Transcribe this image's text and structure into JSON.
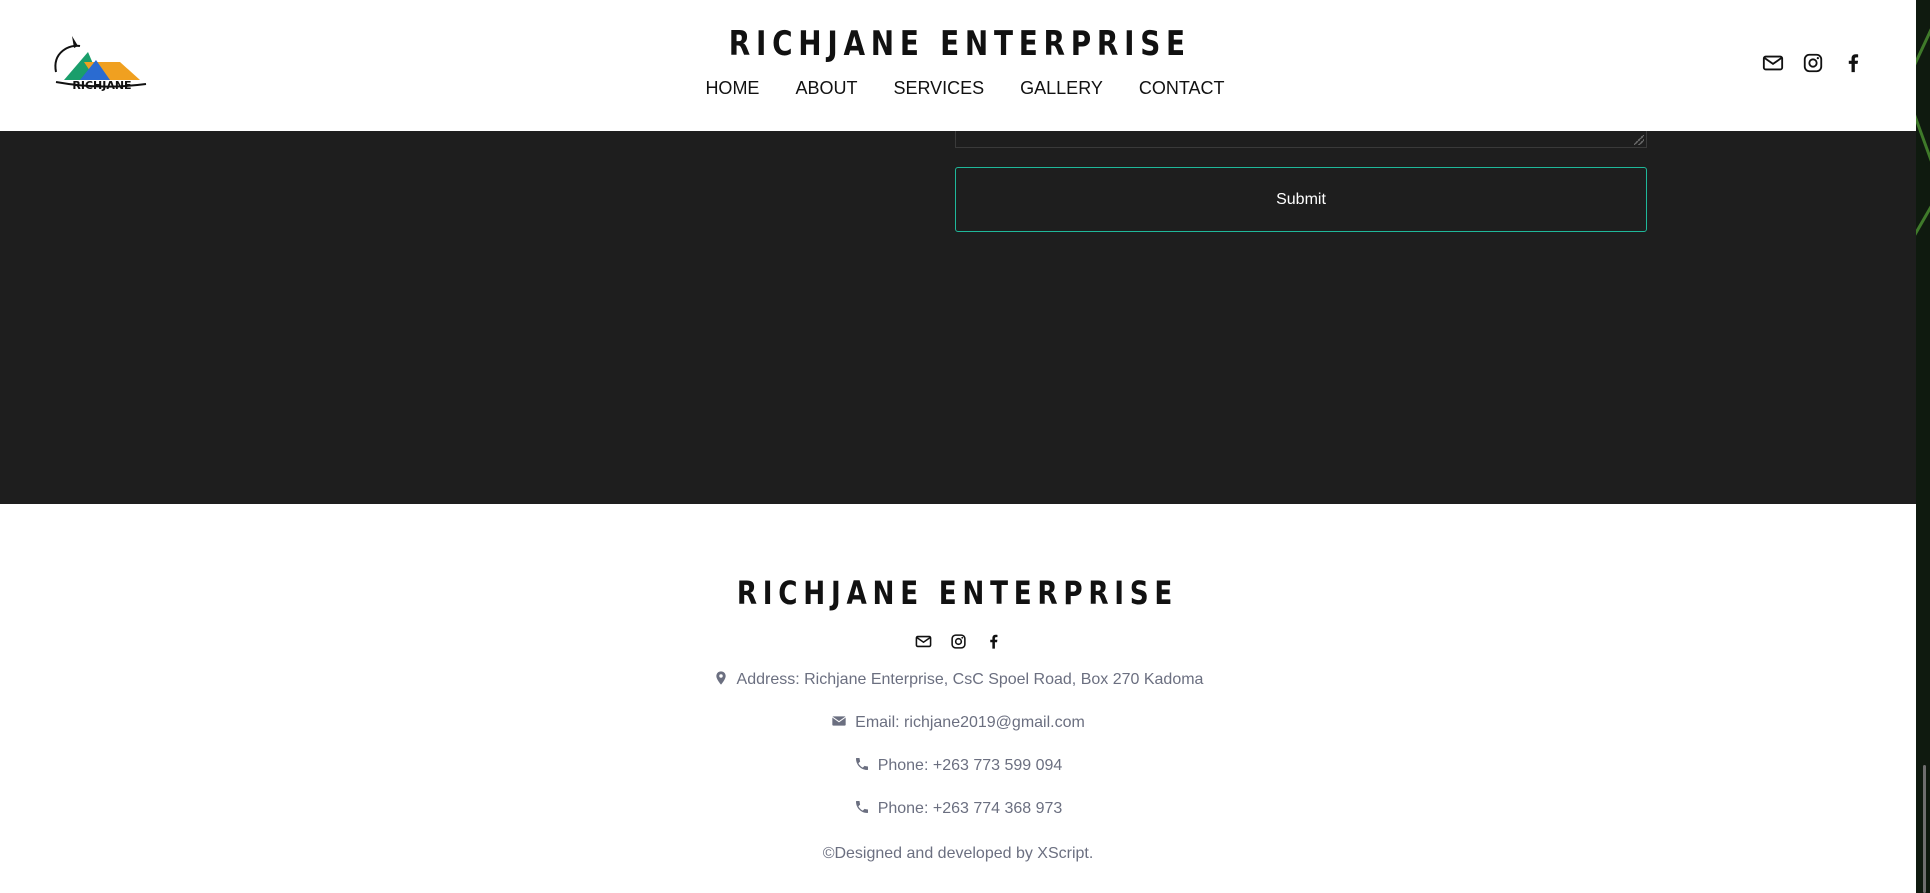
{
  "header": {
    "brand": "RICHJANE ENTERPRISE",
    "logo_text": "RICHJANE",
    "nav": [
      "HOME",
      "ABOUT",
      "SERVICES",
      "GALLERY",
      "CONTACT"
    ],
    "social_icons": [
      "envelope-icon",
      "instagram-icon",
      "facebook-icon"
    ]
  },
  "form": {
    "submit_label": "Submit",
    "accent_color": "#1fb89a"
  },
  "footer": {
    "brand": "RICHJANE ENTERPRISE",
    "social_icons": [
      "envelope-icon",
      "instagram-icon",
      "facebook-icon"
    ],
    "address": "Address: Richjane Enterprise, CsC Spoel Road, Box 270 Kadoma",
    "email": "Email: richjane2019@gmail.com",
    "phone1": "Phone: +263 773 599 094",
    "phone2": "Phone: +263 774 368 973",
    "credit": "©Designed and developed by XScript."
  },
  "colors": {
    "dark_section": "#1e1e1e",
    "footer_text": "#6b6f80"
  }
}
